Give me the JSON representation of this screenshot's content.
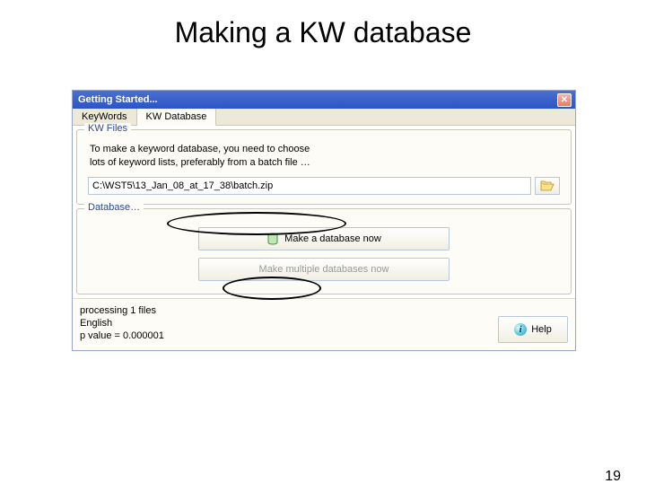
{
  "slide": {
    "title": "Making a KW database",
    "page_number": "19"
  },
  "window": {
    "title": "Getting Started...",
    "tabs": {
      "keywords": "KeyWords",
      "kw_database": "KW Database"
    },
    "kw_files": {
      "legend": "KW Files",
      "instructions": "To make a keyword database, you need to choose lots of keyword lists, preferably from a batch file …",
      "path_value": "C:\\WST5\\13_Jan_08_at_17_38\\batch.zip"
    },
    "database": {
      "legend": "Database…",
      "make_now": "Make a database now",
      "make_multiple": "Make multiple databases now"
    },
    "status": {
      "line1": "processing 1 files",
      "line2": "English",
      "line3": "p value = 0.000001"
    },
    "help_label": "Help"
  }
}
